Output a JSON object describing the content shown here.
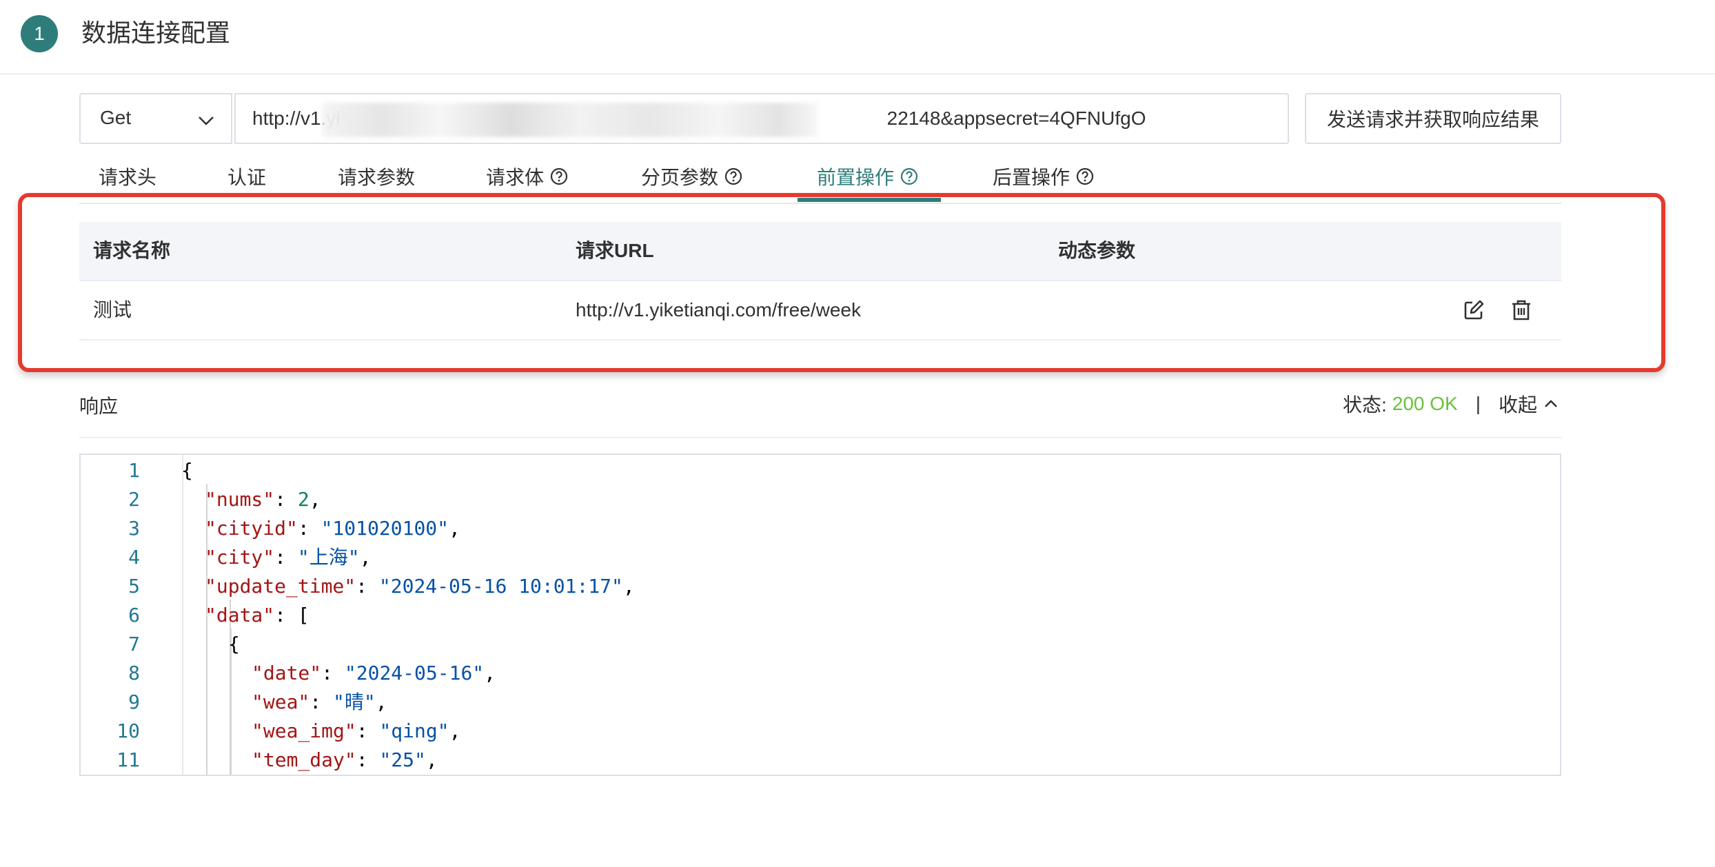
{
  "header": {
    "step_number": "1",
    "title": "数据连接配置"
  },
  "request": {
    "method": "Get",
    "url_prefix": "http://v1.yi",
    "url_suffix": "22148&appsecret=4QFNUfgO",
    "send_label": "发送请求并获取响应结果"
  },
  "tabs": [
    {
      "label": "请求头"
    },
    {
      "label": "认证"
    },
    {
      "label": "请求参数"
    },
    {
      "label": "请求体"
    },
    {
      "label": "分页参数"
    },
    {
      "label": "前置操作",
      "active": true
    },
    {
      "label": "后置操作"
    }
  ],
  "pre_ops_table": {
    "headers": [
      "请求名称",
      "请求URL",
      "动态参数"
    ],
    "rows": [
      {
        "name": "测试",
        "url": "http://v1.yiketianqi.com/free/week",
        "params": ""
      }
    ]
  },
  "response": {
    "label": "响应",
    "status_label": "状态:",
    "status_value": "200 OK",
    "separator": "|",
    "collapse_label": "收起"
  },
  "code": {
    "line_numbers": [
      "1",
      "2",
      "3",
      "4",
      "5",
      "6",
      "7",
      "8",
      "9",
      "10",
      "11"
    ],
    "brace_open": "{",
    "nums_key": "\"nums\"",
    "nums_val": "2",
    "cityid_key": "\"cityid\"",
    "cityid_val": "\"101020100\"",
    "city_key": "\"city\"",
    "city_val": "\"上海\"",
    "update_key": "\"update_time\"",
    "update_val": "\"2024-05-16 10:01:17\"",
    "data_key": "\"data\"",
    "bracket_open": "[",
    "obj_open": "{",
    "date_key": "\"date\"",
    "date_val": "\"2024-05-16\"",
    "wea_key": "\"wea\"",
    "wea_val": "\"晴\"",
    "wea_img_key": "\"wea_img\"",
    "wea_img_val": "\"qing\"",
    "tem_day_key": "\"tem_day\"",
    "tem_day_val": "\"25\""
  },
  "colors": {
    "accent": "#2e7d7a",
    "highlight": "#e53a2f",
    "status_ok": "#67c23a"
  }
}
